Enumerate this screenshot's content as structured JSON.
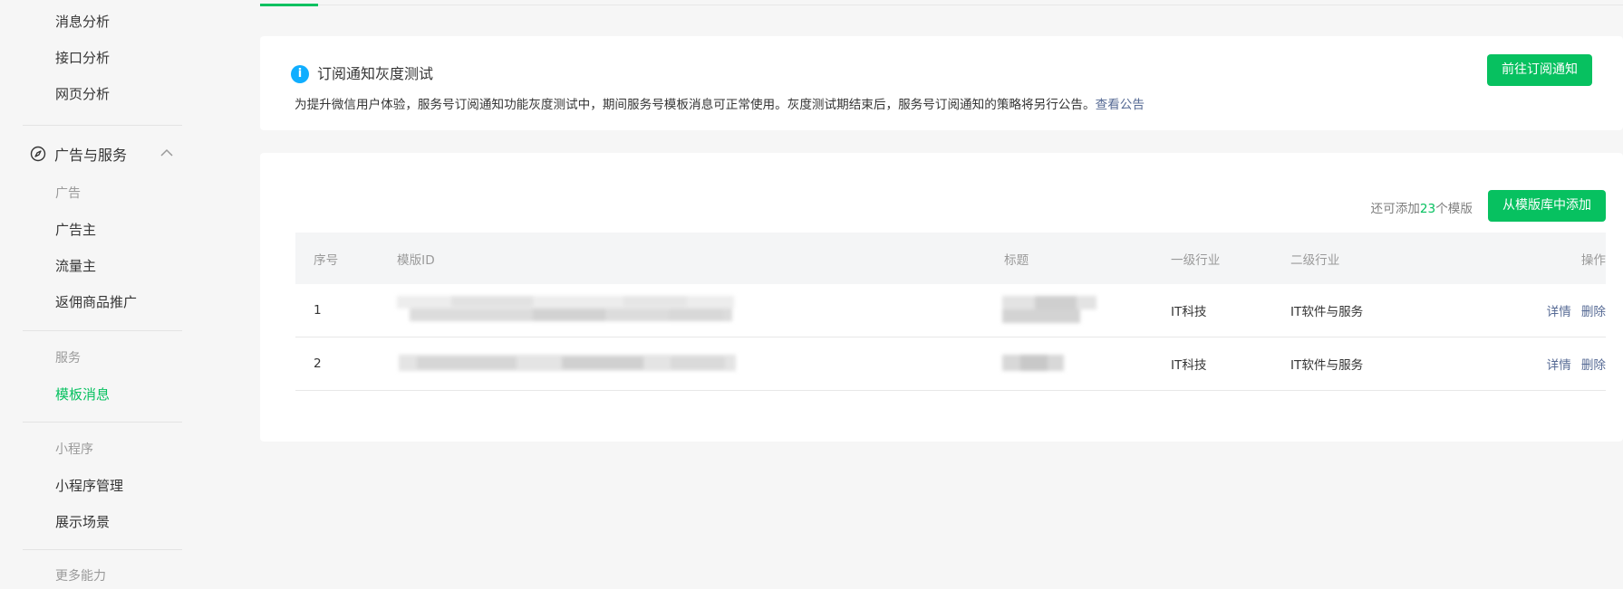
{
  "sidebar": {
    "top_items": [
      {
        "label": "消息分析"
      },
      {
        "label": "接口分析"
      },
      {
        "label": "网页分析"
      }
    ],
    "section": {
      "title": "广告与服务",
      "icon": "compass-icon",
      "expanded": true
    },
    "groups": {
      "ads": {
        "title": "广告",
        "items": [
          {
            "label": "广告主"
          },
          {
            "label": "流量主"
          },
          {
            "label": "返佣商品推广"
          }
        ]
      },
      "service": {
        "title": "服务",
        "items": [
          {
            "label": "模板消息",
            "active": true
          }
        ]
      },
      "miniprogram": {
        "title": "小程序",
        "items": [
          {
            "label": "小程序管理"
          },
          {
            "label": "展示场景"
          }
        ]
      },
      "more": {
        "title": "更多能力"
      }
    }
  },
  "notice": {
    "icon": "info-icon",
    "icon_glyph": "i",
    "title": "订阅通知灰度测试",
    "desc": "为提升微信用户体验，服务号订阅通知功能灰度测试中，期间服务号模板消息可正常使用。灰度测试期结束后，服务号订阅通知的策略将另行公告。",
    "link": "查看公告",
    "button": "前往订阅通知"
  },
  "templates": {
    "quota_prefix": "还可添加",
    "quota_count": "23",
    "quota_suffix": "个模版",
    "add_button": "从模版库中添加",
    "columns": [
      "序号",
      "模版ID",
      "标题",
      "一级行业",
      "二级行业",
      "操作"
    ],
    "rows": [
      {
        "index": "1",
        "industry1": "IT科技",
        "industry2": "IT软件与服务",
        "detail": "详情",
        "delete": "删除"
      },
      {
        "index": "2",
        "industry1": "IT科技",
        "industry2": "IT软件与服务",
        "detail": "详情",
        "delete": "删除"
      }
    ]
  },
  "colors": {
    "brand_green": "#07c160",
    "link_blue": "#576b95",
    "info_blue": "#10aeff",
    "background": "#f6f6f6"
  }
}
